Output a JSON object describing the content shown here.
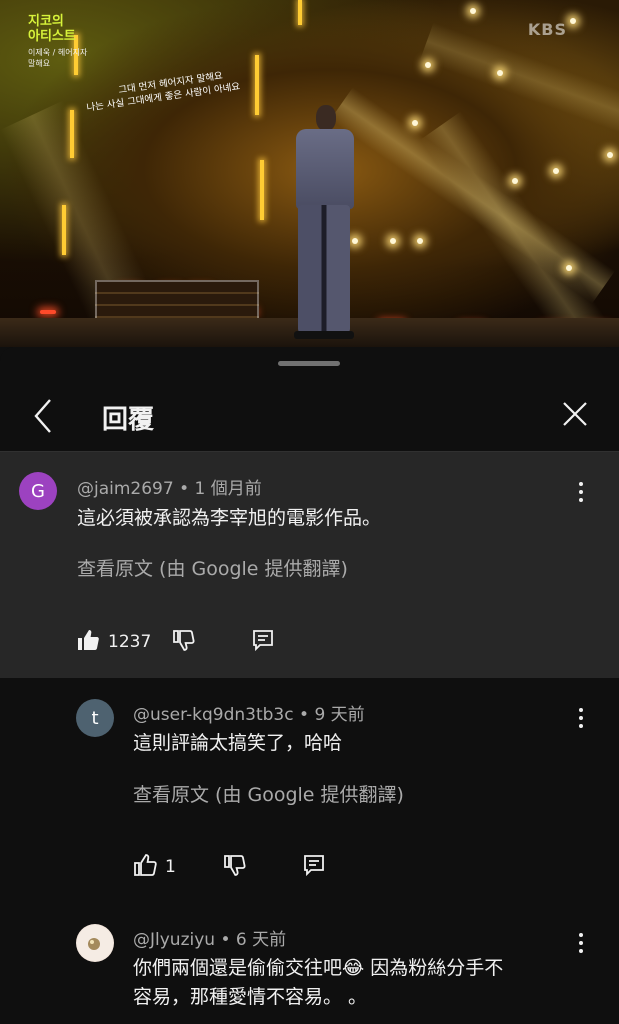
{
  "video": {
    "show_logo_line1": "지코의",
    "show_logo_line2": "아티스트",
    "show_logo_sub": "이제욱 / 헤어지자 말해요",
    "channel_watermark": "KBS",
    "lyric_line1": "그대 먼저 헤어지자 말해요",
    "lyric_line2": "나는 사실 그대에게 좋은 사람이 아녜요"
  },
  "header": {
    "title": "回覆",
    "back_icon": "chevron-left-icon",
    "close_icon": "close-icon"
  },
  "parent_comment": {
    "avatar_letter": "G",
    "avatar_color": "#9c42c0",
    "author": "@jaim2697",
    "separator": "•",
    "time": "1 個月前",
    "text": "這必須被承認為李宰旭的電影作品。",
    "translate_label": "查看原文 (由 Google 提供翻譯)",
    "likes": "1237"
  },
  "replies": [
    {
      "avatar_letter": "t",
      "avatar_color": "#4e6270",
      "author": "@user-kq9dn3tb3c",
      "separator": "•",
      "time": "9 天前",
      "text": "這則評論太搞笑了，哈哈",
      "translate_label": "查看原文 (由 Google 提供翻譯)",
      "likes": "1"
    },
    {
      "avatar_letter": "",
      "avatar_color": "#f3e6dc",
      "author": "@Jlyuziyu",
      "separator": "•",
      "time": "6 天前",
      "text_line1": "你們兩個還是偷偷交往吧😂 因為粉絲分手不",
      "text_line2": "容易，那種愛情不容易。 。"
    }
  ]
}
